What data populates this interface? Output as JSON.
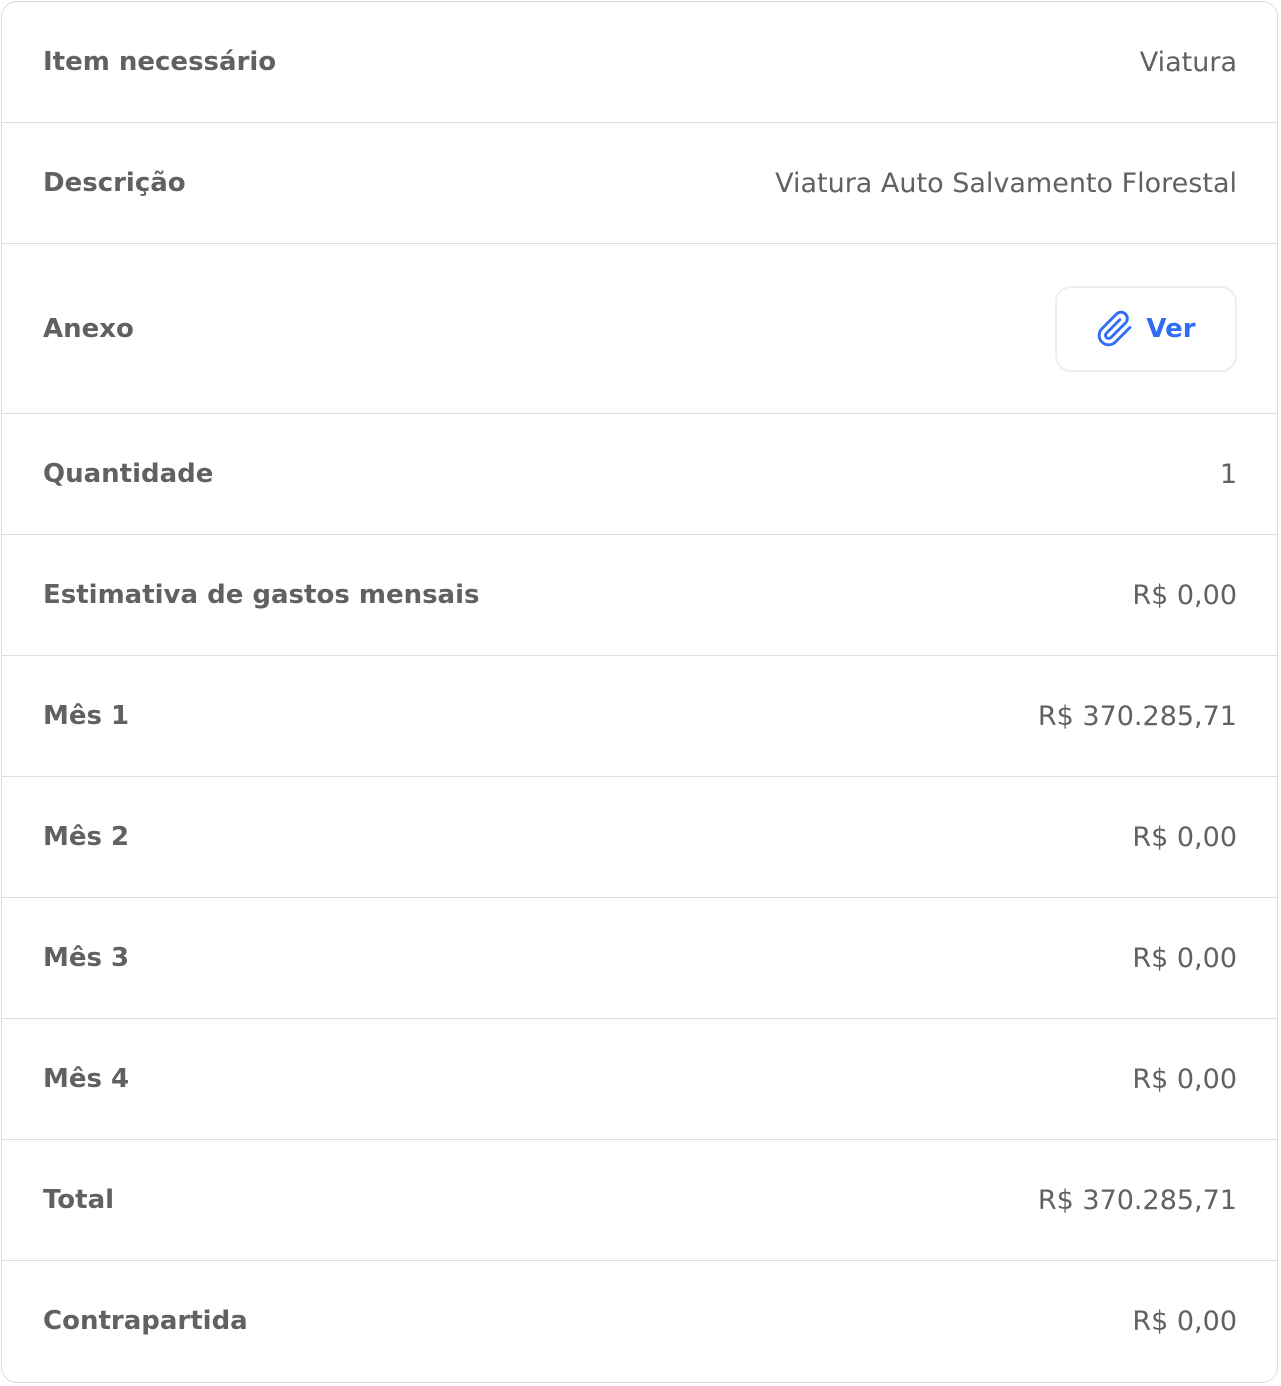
{
  "colors": {
    "label": "#616161",
    "value": "#616161",
    "accent": "#2f6df6",
    "divider": "#dedede"
  },
  "rows": [
    {
      "label": "Item necessário",
      "value": "Viatura"
    },
    {
      "label": "Descrição",
      "value": "Viatura Auto Salvamento Florestal"
    },
    {
      "label": "Anexo",
      "button_label": "Ver",
      "button_icon": "paperclip-icon"
    },
    {
      "label": "Quantidade",
      "value": "1"
    },
    {
      "label": "Estimativa de gastos mensais",
      "value": "R$ 0,00"
    },
    {
      "label": "Mês 1",
      "value": "R$ 370.285,71"
    },
    {
      "label": "Mês 2",
      "value": "R$ 0,00"
    },
    {
      "label": "Mês 3",
      "value": "R$ 0,00"
    },
    {
      "label": "Mês 4",
      "value": "R$ 0,00"
    },
    {
      "label": "Total",
      "value": "R$ 370.285,71"
    },
    {
      "label": "Contrapartida",
      "value": "R$ 0,00"
    }
  ]
}
